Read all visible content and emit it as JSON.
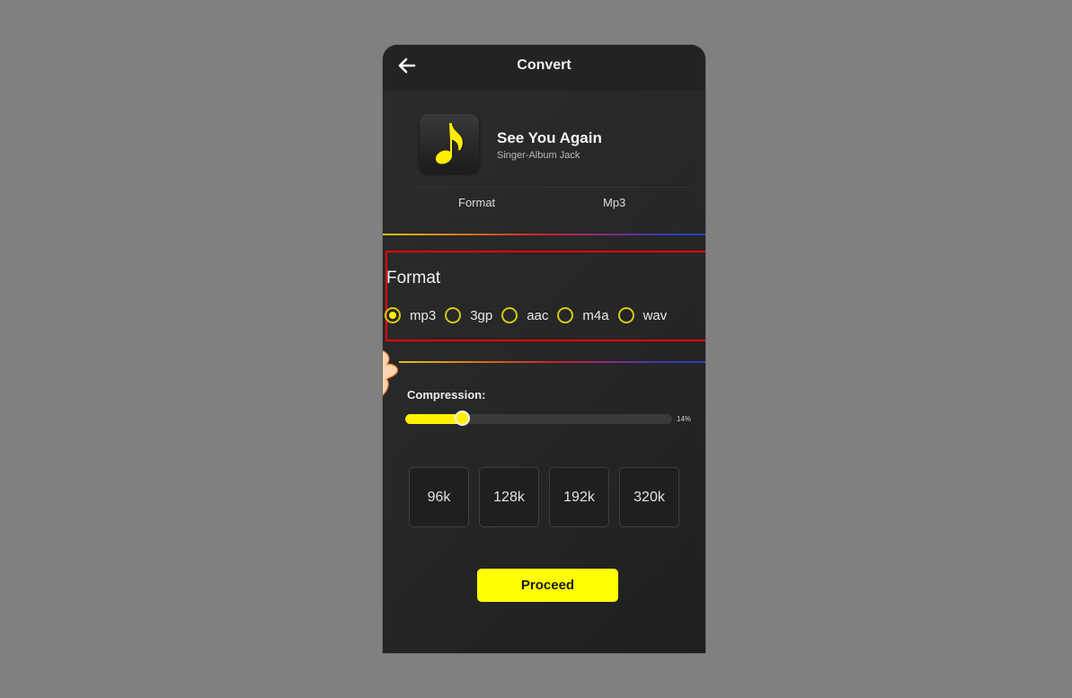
{
  "header": {
    "title": "Convert",
    "back_icon": "arrow-left-icon"
  },
  "track": {
    "art_icon": "music-note-icon",
    "title": "See You Again",
    "subtitle": "Singer-Album  Jack",
    "info_label": "Format",
    "info_value": "Mp3"
  },
  "format_section": {
    "heading": "Format",
    "options": [
      {
        "label": "mp3",
        "selected": true
      },
      {
        "label": "3gp",
        "selected": false
      },
      {
        "label": "aac",
        "selected": false
      },
      {
        "label": "m4a",
        "selected": false
      },
      {
        "label": "wav",
        "selected": false
      }
    ]
  },
  "compression": {
    "label": "Compression:",
    "value_percent": 14,
    "value_text": "14%",
    "accent": "#fff200"
  },
  "bitrates": [
    "96k",
    "128k",
    "192k",
    "320k"
  ],
  "proceed_label": "Proceed"
}
